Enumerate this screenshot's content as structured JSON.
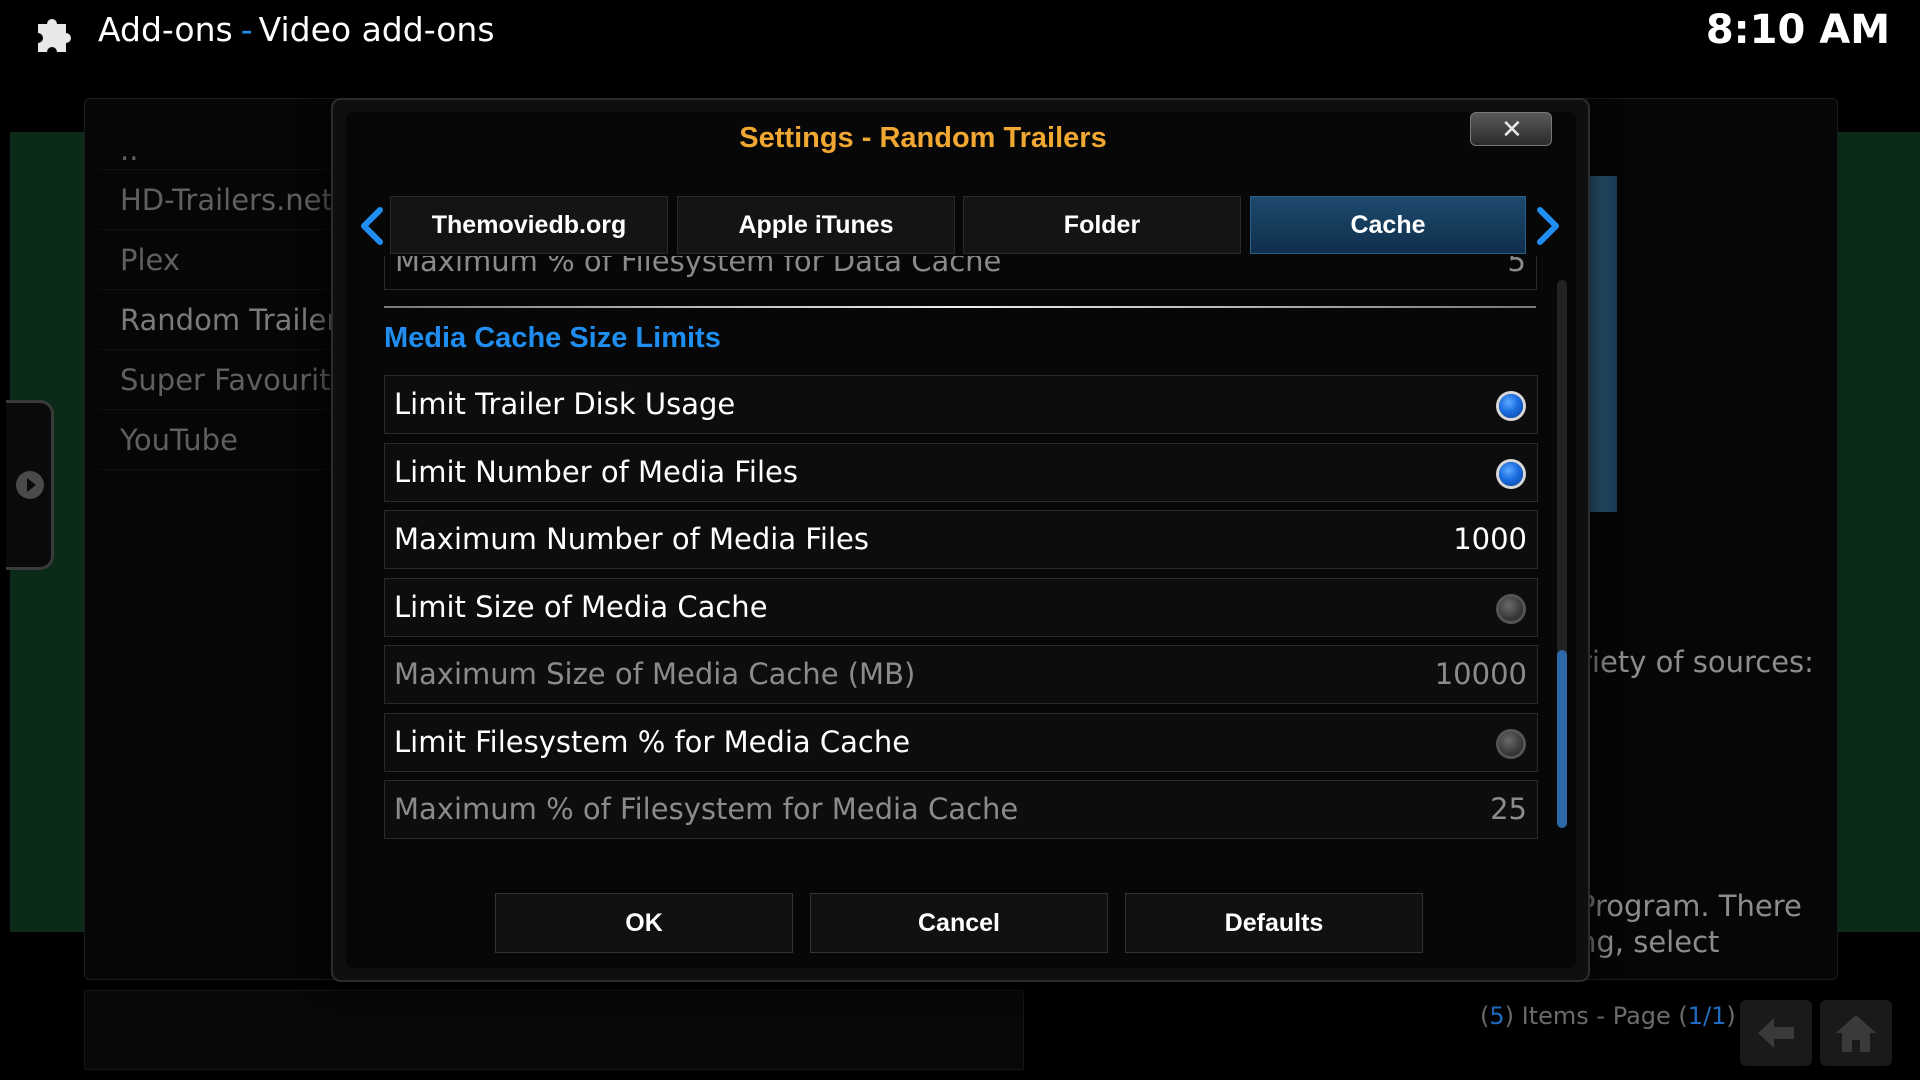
{
  "header": {
    "section": "Add-ons",
    "separator": "-",
    "subsection": "Video add-ons",
    "clock": "8:10 AM"
  },
  "background": {
    "list_items": [
      "..",
      "HD-Trailers.net",
      "Plex",
      "Random Trailers",
      "Super Favourites",
      "YouTube"
    ],
    "description_fragment_1": "riety of sources:",
    "description_fragment_2a": "Program. There",
    "description_fragment_2b": "ng, select",
    "page_info": {
      "open": "(",
      "count": "5",
      "items_text": ") Items - Page (",
      "page": "1/1",
      "close": ")"
    }
  },
  "dialog": {
    "title": "Settings - Random Trailers",
    "close_glyph": "✕",
    "tabs": [
      {
        "label": "Themoviedb.org",
        "active": false
      },
      {
        "label": "Apple iTunes",
        "active": false
      },
      {
        "label": "Folder",
        "active": false
      },
      {
        "label": "Cache",
        "active": true
      }
    ],
    "partial_row": {
      "label": "Maximum % of Filesystem for Data Cache",
      "value": "5"
    },
    "section_title": "Media Cache Size Limits",
    "rows": [
      {
        "label": "Limit Trailer Disk Usage",
        "type": "toggle",
        "checked": true,
        "enabled": true
      },
      {
        "label": "Limit Number of Media Files",
        "type": "toggle",
        "checked": true,
        "enabled": true
      },
      {
        "label": "Maximum Number of Media Files",
        "type": "value",
        "value": "1000",
        "enabled": true
      },
      {
        "label": "Limit Size of Media Cache",
        "type": "toggle",
        "checked": false,
        "enabled": true
      },
      {
        "label": "Maximum Size of Media Cache (MB)",
        "type": "value",
        "value": "10000",
        "enabled": false
      },
      {
        "label": "Limit Filesystem % for Media Cache",
        "type": "toggle",
        "checked": false,
        "enabled": true
      },
      {
        "label": "Maximum % of Filesystem for Media Cache",
        "type": "value",
        "value": "25",
        "enabled": false
      }
    ],
    "buttons": {
      "ok": "OK",
      "cancel": "Cancel",
      "defaults": "Defaults"
    }
  },
  "colors": {
    "accent_blue": "#1f8ef0",
    "title_orange": "#f0a832",
    "active_tab": "#1d4a6e",
    "toggle_on": "#1a6ee0"
  },
  "icons": [
    "addons-puzzle-icon",
    "chevron-left-icon",
    "chevron-right-icon",
    "close-icon",
    "back-arrow-icon",
    "home-icon",
    "play-icon"
  ]
}
